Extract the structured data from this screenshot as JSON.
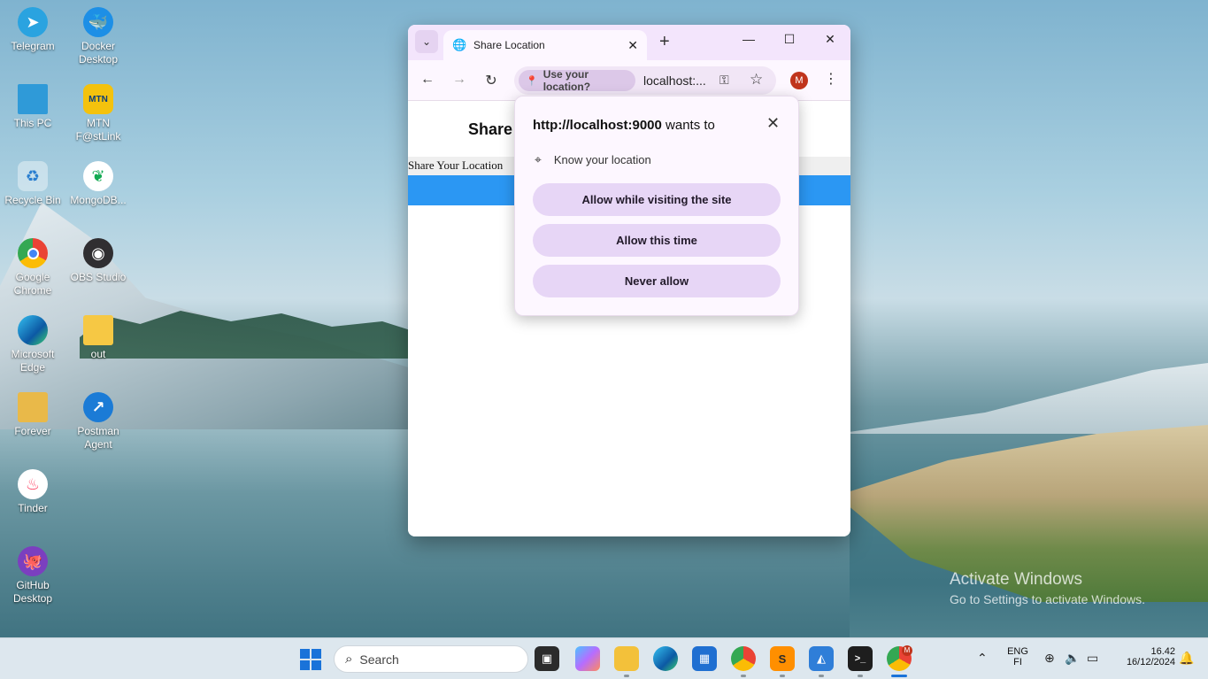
{
  "desktop": {
    "icons": [
      {
        "label": "Telegram"
      },
      {
        "label": "Docker Desktop"
      },
      {
        "label": "This PC"
      },
      {
        "label": "MTN F@stLink"
      },
      {
        "label": "Recycle Bin"
      },
      {
        "label": "MongoDB..."
      },
      {
        "label": "Google Chrome"
      },
      {
        "label": "OBS Studio"
      },
      {
        "label": "Microsoft Edge"
      },
      {
        "label": "out"
      },
      {
        "label": "Forever"
      },
      {
        "label": "Postman Agent"
      },
      {
        "label": "Tinder"
      },
      {
        "label": "GitHub Desktop"
      }
    ],
    "activation": {
      "line1": "Activate Windows",
      "line2": "Go to Settings to activate Windows."
    }
  },
  "browser": {
    "tab": {
      "title": "Share Location"
    },
    "toolbar": {
      "location_chip": "Use your location?",
      "url": "localhost:...",
      "profile_initial": "M"
    },
    "page": {
      "heading": "Share",
      "share_label": "Share Your Location"
    },
    "permission_popup": {
      "origin": "http://localhost:9000",
      "title_suffix": " wants to",
      "permission": "Know your location",
      "buttons": [
        "Allow while visiting the site",
        "Allow this time",
        "Never allow"
      ]
    }
  },
  "taskbar": {
    "search_placeholder": "Search",
    "language": "ENG",
    "region": "FI",
    "time": "16.42",
    "date": "16/12/2024",
    "chrome_badge": "M"
  }
}
